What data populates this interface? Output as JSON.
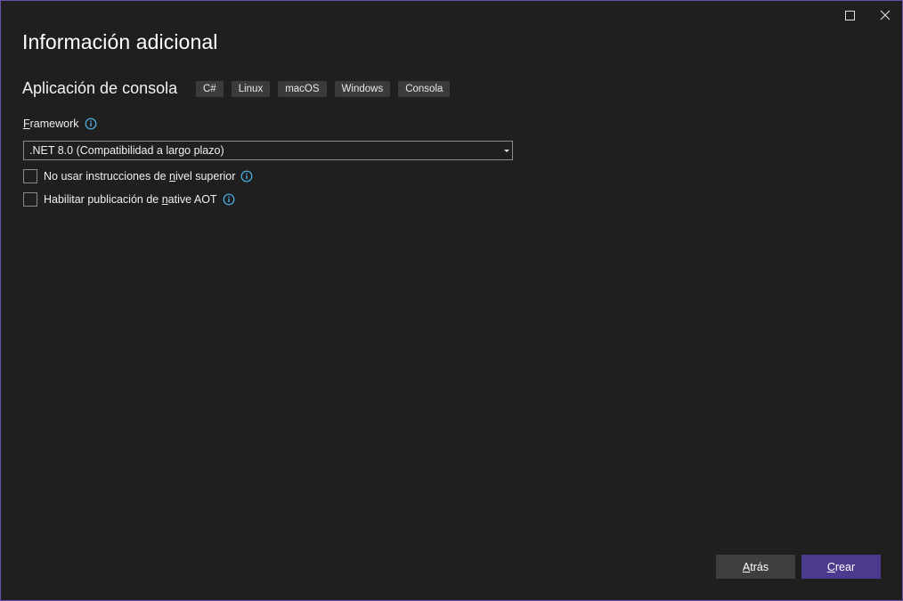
{
  "window": {
    "maximize_label": "maximize",
    "close_label": "close"
  },
  "header": {
    "title": "Información adicional"
  },
  "project": {
    "name": "Aplicación de consola",
    "tags": [
      "C#",
      "Linux",
      "macOS",
      "Windows",
      "Consola"
    ]
  },
  "framework": {
    "label_prefix": "F",
    "label_rest": "ramework",
    "selected": ".NET 8.0 (Compatibilidad a largo plazo)"
  },
  "options": {
    "top_level": {
      "label_a": "No usar instrucciones de ",
      "label_u": "n",
      "label_b": "ivel superior",
      "checked": false
    },
    "native_aot": {
      "label_a": "Habilitar publicación de ",
      "label_u": "n",
      "label_b": "ative AOT",
      "checked": false
    }
  },
  "footer": {
    "back_u": "A",
    "back_rest": "trás",
    "create_u": "C",
    "create_rest": "rear"
  },
  "colors": {
    "background": "#1f1f1f",
    "border_accent": "#6b4fa8",
    "primary_button": "#4c3a8e",
    "secondary_button": "#3e3e3e",
    "info_icon": "#4fb3e8"
  }
}
